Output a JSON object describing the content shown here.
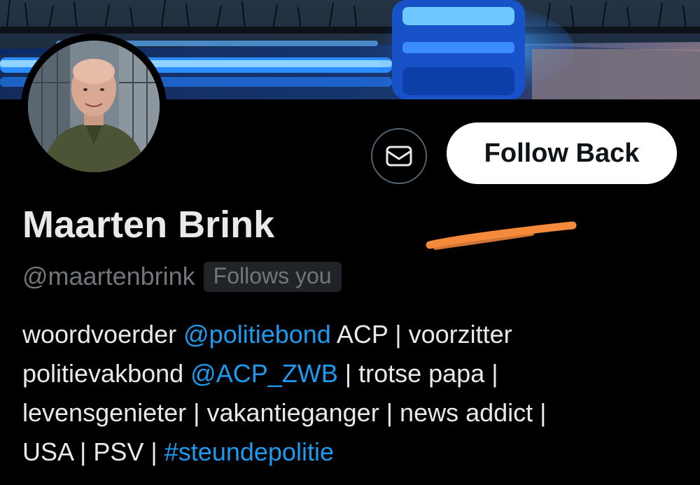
{
  "profile": {
    "display_name": "Maarten Brink",
    "handle": "@maartenbrink",
    "follows_you_badge": "Follows you",
    "follow_button_label": "Follow Back",
    "message_button_icon": "envelope-icon",
    "avatar_icon": "avatar-photo"
  },
  "bio": {
    "line1": {
      "t1": "woordvoerder ",
      "m1": "@politiebond",
      "t2": " ACP | voorzitter"
    },
    "line2": {
      "t1": "politievakbond ",
      "m1": "@ACP_ZWB",
      "t2": " | trotse papa |"
    },
    "line3": {
      "t1": "levensgenieter | vakantieganger | news addict |"
    },
    "line4": {
      "t1": "USA | PSV | ",
      "m1": "#steundepolitie"
    }
  },
  "annotation": {
    "color": "#f48a3c",
    "shape": "hand-drawn orange arrow line pointing at display name"
  },
  "colors": {
    "background": "#000000",
    "text": "#e7e9ea",
    "secondary_text": "#71767b",
    "link": "#1d9bf0",
    "follow_button_bg": "#ffffff"
  }
}
